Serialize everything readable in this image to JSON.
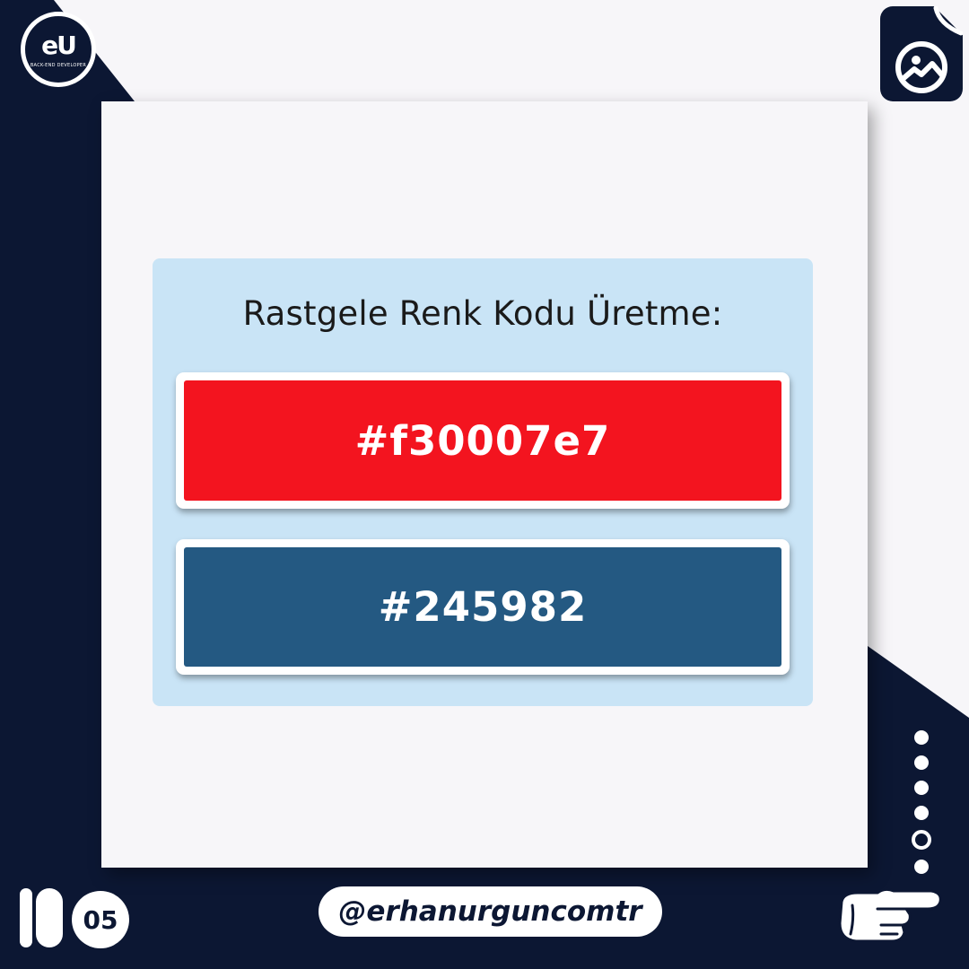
{
  "brand": {
    "logo_letters": "eU",
    "logo_tagline": "BACK-END DEVELOPER"
  },
  "panel": {
    "title": "Rastgele Renk Kodu Üretme:",
    "colors": [
      {
        "code": "#f30007e7",
        "swatch": "#f3141f"
      },
      {
        "code": "#245982",
        "swatch": "#245982"
      }
    ]
  },
  "footer": {
    "page_number": "05",
    "handle": "@erhanurguncomtr"
  },
  "theme": {
    "navy": "#0c1733",
    "panel_bg": "#c9e4f6",
    "card_bg": "#f7f6f9"
  },
  "icons": [
    "image-file-icon",
    "pointing-hand-icon",
    "carousel-dots-icon"
  ]
}
